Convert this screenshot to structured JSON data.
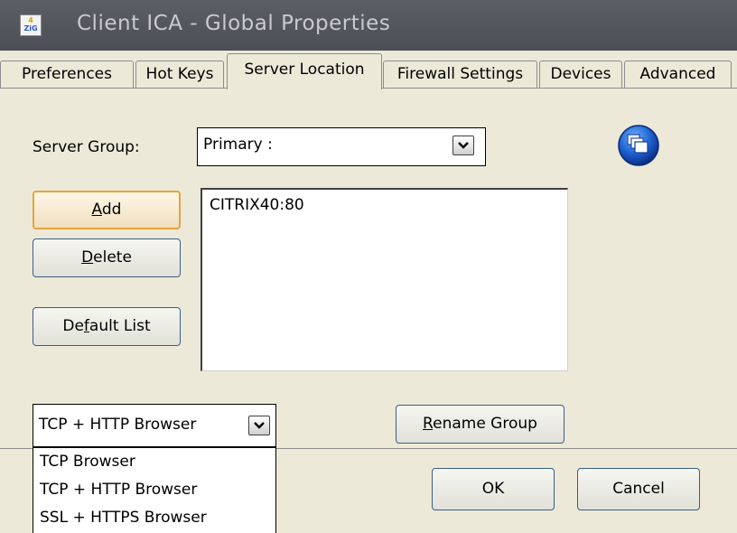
{
  "window": {
    "title": "Client ICA - Global Properties"
  },
  "tabs": [
    {
      "label": "Preferences",
      "active": false
    },
    {
      "label": "Hot Keys",
      "active": false
    },
    {
      "label": "Server Location",
      "active": true
    },
    {
      "label": "Firewall Settings",
      "active": false
    },
    {
      "label": "Devices",
      "active": false
    },
    {
      "label": "Advanced",
      "active": false
    }
  ],
  "server_group": {
    "label": "Server Group:",
    "value": "Primary :"
  },
  "buttons": {
    "add": {
      "pre": "",
      "u": "A",
      "post": "dd"
    },
    "delete": {
      "pre": "",
      "u": "D",
      "post": "elete"
    },
    "default_list": {
      "pre": "De",
      "u": "f",
      "post": "ault List"
    },
    "rename_group": {
      "pre": "",
      "u": "R",
      "post": "ename Group"
    },
    "ok": "OK",
    "cancel": "Cancel"
  },
  "server_list": [
    "CITRIX40:80"
  ],
  "protocol": {
    "selected": "TCP + HTTP Browser",
    "options": [
      "TCP Browser",
      "TCP + HTTP Browser",
      "SSL + HTTPS Browser"
    ]
  },
  "icons": {
    "app": "zig-app-icon",
    "globe": "globe-windows-icon",
    "dropdown": "chevron-down-icon"
  },
  "colors": {
    "titlebar": "#55585f",
    "dialog_bg": "#ece9d8",
    "focus_border": "#e5a43a",
    "globe_blue": "#1c5fd0"
  }
}
